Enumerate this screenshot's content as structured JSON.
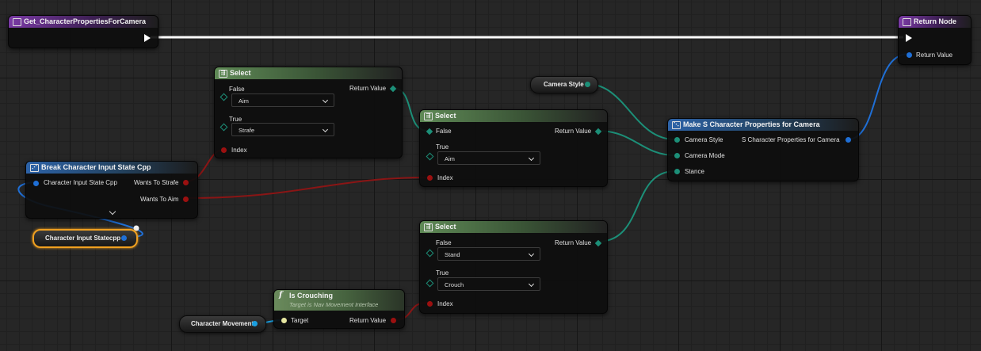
{
  "nodes": {
    "entry": {
      "title": "Get_CharacterPropertiesForCamera"
    },
    "return_node": {
      "title": "Return Node",
      "pin_return_value": "Return Value"
    },
    "select1": {
      "title": "Select",
      "pin_false": "False",
      "false_value": "Aim",
      "pin_true": "True",
      "true_value": "Strafe",
      "pin_index": "Index",
      "pin_return_value": "Return Value"
    },
    "select2": {
      "title": "Select",
      "pin_false": "False",
      "pin_true": "True",
      "true_value": "Aim",
      "pin_index": "Index",
      "pin_return_value": "Return Value"
    },
    "select3": {
      "title": "Select",
      "pin_false": "False",
      "false_value": "Stand",
      "pin_true": "True",
      "true_value": "Crouch",
      "pin_index": "Index",
      "pin_return_value": "Return Value"
    },
    "break_input": {
      "title": "Break Character Input State Cpp",
      "pin_input": "Character Input State Cpp",
      "pin_wants_strafe": "Wants To Strafe",
      "pin_wants_aim": "Wants To Aim"
    },
    "make_props": {
      "title": "Make S Character Properties for Camera",
      "pin_camera_style": "Camera Style",
      "pin_camera_mode": "Camera Mode",
      "pin_stance": "Stance",
      "pin_output": "S Character Properties for Camera"
    },
    "is_crouching": {
      "title": "Is Crouching",
      "subtitle": "Target is Nav Movement Interface",
      "pin_target": "Target",
      "pin_return_value": "Return Value"
    }
  },
  "variables": {
    "camera_style": "Camera Style",
    "character_input_state": "Character Input Statecpp",
    "character_movement": "Character Movement"
  },
  "colors": {
    "exec": "#ffffff",
    "struct": "#1f6fd6",
    "bool": "#9b1010",
    "enum": "#1c8f78",
    "object": "#1a9fe0",
    "selected": "#f0a020"
  }
}
